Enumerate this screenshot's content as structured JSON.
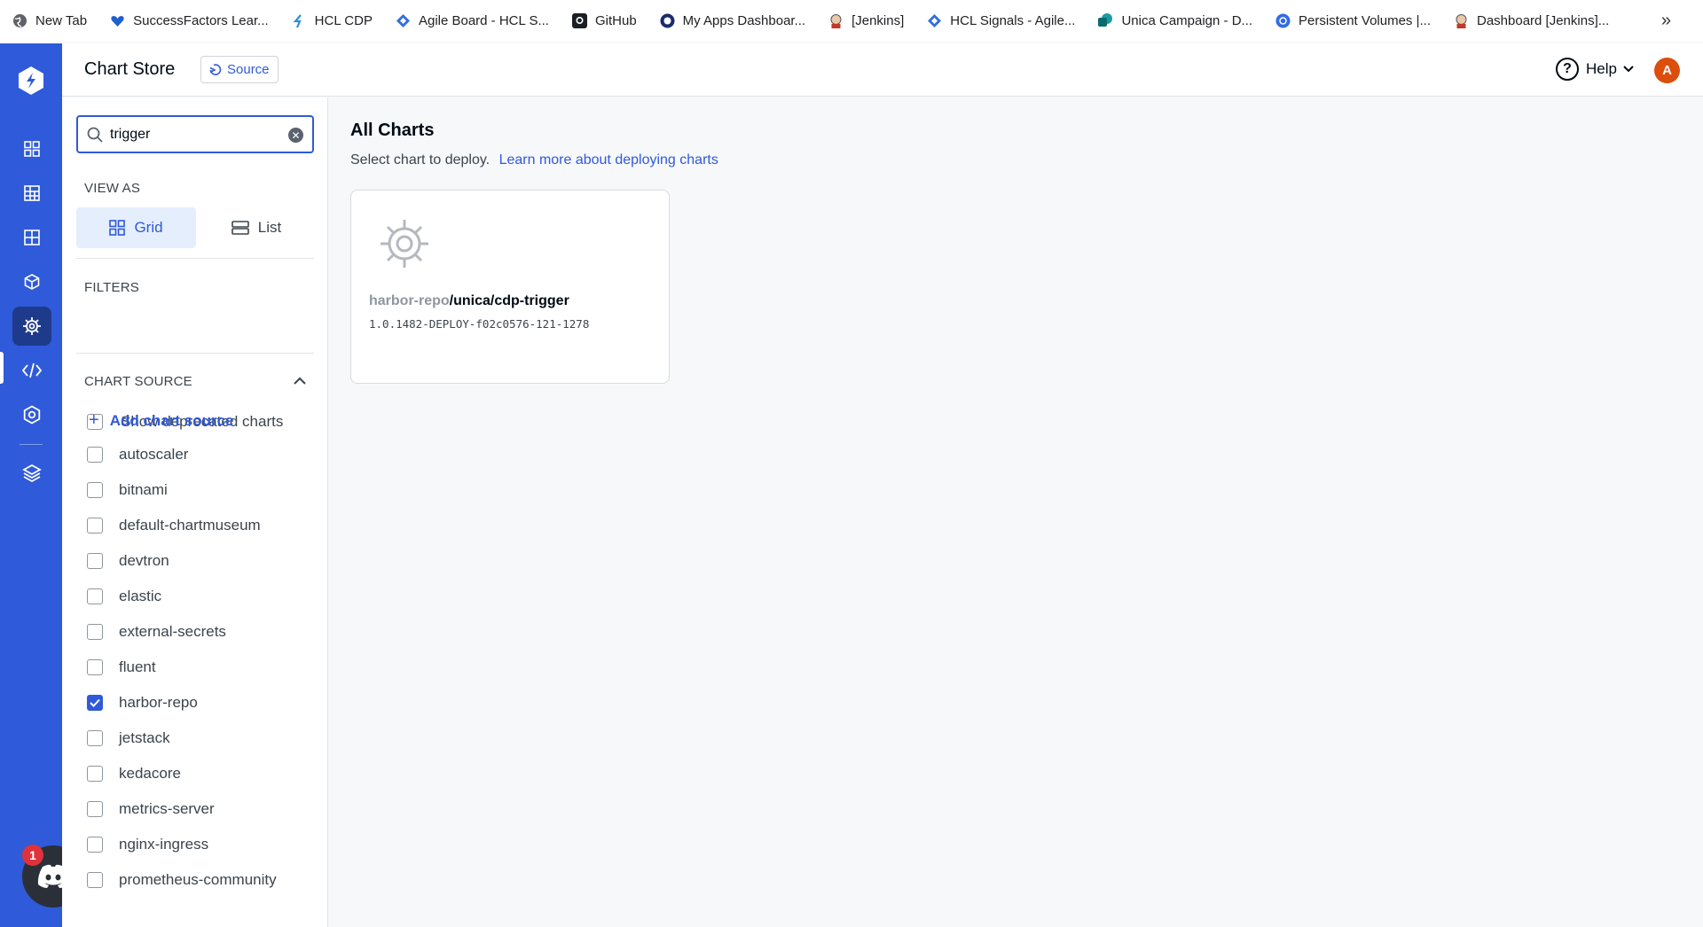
{
  "bookmarks": [
    {
      "label": "New Tab",
      "icon": "globe-icon"
    },
    {
      "label": "SuccessFactors Lear...",
      "icon": "heart-icon"
    },
    {
      "label": "HCL CDP",
      "icon": "hcl-cdp-icon"
    },
    {
      "label": "Agile Board - HCL S...",
      "icon": "diamond-icon"
    },
    {
      "label": "GitHub",
      "icon": "github-icon"
    },
    {
      "label": "My Apps Dashboar...",
      "icon": "circle-icon"
    },
    {
      "label": "[Jenkins]",
      "icon": "jenkins-icon"
    },
    {
      "label": "HCL Signals - Agile...",
      "icon": "diamond-icon"
    },
    {
      "label": "Unica Campaign - D...",
      "icon": "sharepoint-icon"
    },
    {
      "label": "Persistent Volumes |...",
      "icon": "kubernetes-icon"
    },
    {
      "label": "Dashboard [Jenkins]...",
      "icon": "jenkins-icon"
    }
  ],
  "header": {
    "title": "Chart Store",
    "source_label": "Source",
    "help_label": "Help",
    "avatar_initial": "A"
  },
  "search": {
    "value": "trigger"
  },
  "view_as": {
    "label": "VIEW AS",
    "grid_label": "Grid",
    "list_label": "List",
    "selected": "Grid"
  },
  "filters": {
    "label": "FILTERS",
    "deprecated_label": "Show deprecated charts"
  },
  "chart_source": {
    "label": "CHART SOURCE",
    "add_label": "Add chart source",
    "items": [
      {
        "name": "autoscaler",
        "checked": false
      },
      {
        "name": "bitnami",
        "checked": false
      },
      {
        "name": "default-chartmuseum",
        "checked": false
      },
      {
        "name": "devtron",
        "checked": false
      },
      {
        "name": "elastic",
        "checked": false
      },
      {
        "name": "external-secrets",
        "checked": false
      },
      {
        "name": "fluent",
        "checked": false
      },
      {
        "name": "harbor-repo",
        "checked": true
      },
      {
        "name": "jetstack",
        "checked": false
      },
      {
        "name": "kedacore",
        "checked": false
      },
      {
        "name": "metrics-server",
        "checked": false
      },
      {
        "name": "nginx-ingress",
        "checked": false
      },
      {
        "name": "prometheus-community",
        "checked": false
      }
    ]
  },
  "main": {
    "title": "All Charts",
    "subtitle": "Select chart to deploy.",
    "learn_link": "Learn more about deploying charts",
    "charts": [
      {
        "repo": "harbor-repo",
        "name": "/unica/cdp-trigger",
        "version": "1.0.1482-DEPLOY-f02c0576-121-1278"
      }
    ]
  },
  "discord": {
    "badge": "1"
  },
  "colors": {
    "accent": "#2f5ad9",
    "rail": "#2f5ad9",
    "avatar": "#dc4e0c",
    "badge": "#e0323a"
  }
}
